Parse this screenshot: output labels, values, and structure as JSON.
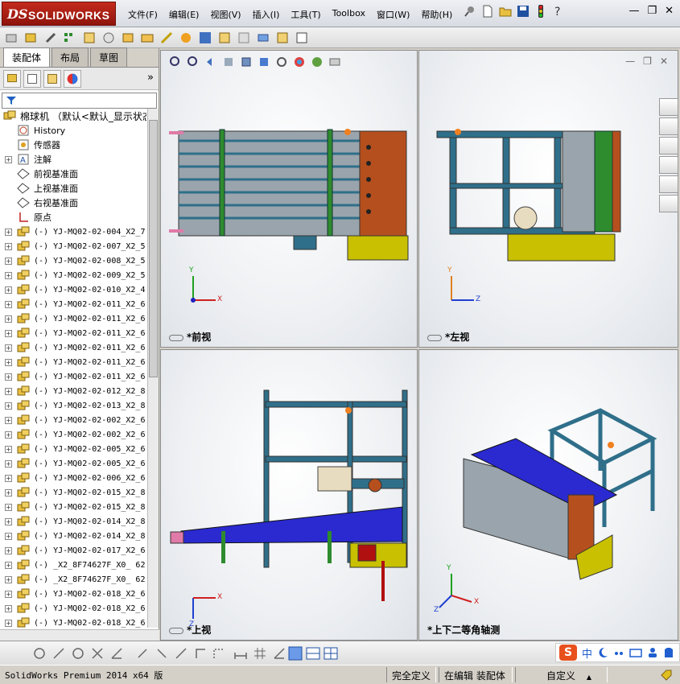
{
  "app": {
    "logo_ds": "DS",
    "logo_text": "SOLIDWORKS"
  },
  "menu": [
    "文件(F)",
    "编辑(E)",
    "视图(V)",
    "插入(I)",
    "工具(T)",
    "Toolbox",
    "窗口(W)",
    "帮助(H)"
  ],
  "window_controls": {
    "minimize": "—",
    "restore": "❐",
    "close": "✕"
  },
  "left_panel": {
    "tabs": [
      "装配体",
      "布局",
      "草图"
    ],
    "active_tab": "装配体",
    "more": "»",
    "root": "棉球机 （默认<默认_显示状态",
    "items": [
      {
        "label": "History",
        "icon": "history-icon",
        "expand": false,
        "mono": false
      },
      {
        "label": "传感器",
        "icon": "sensor-icon",
        "expand": false,
        "mono": false
      },
      {
        "label": "注解",
        "icon": "annotation-icon",
        "expand": true,
        "mono": false
      },
      {
        "label": "前视基准面",
        "icon": "plane-icon",
        "expand": false,
        "mono": false
      },
      {
        "label": "上视基准面",
        "icon": "plane-icon",
        "expand": false,
        "mono": false
      },
      {
        "label": "右视基准面",
        "icon": "plane-icon",
        "expand": false,
        "mono": false
      },
      {
        "label": "原点",
        "icon": "origin-icon",
        "expand": false,
        "mono": false
      },
      {
        "label": "(-) YJ-MQ02-02-004_X2_7",
        "icon": "part-icon",
        "expand": true,
        "mono": true
      },
      {
        "label": "(-) YJ-MQ02-02-007_X2_5",
        "icon": "part-icon",
        "expand": true,
        "mono": true
      },
      {
        "label": "(-) YJ-MQ02-02-008_X2_5",
        "icon": "part-icon",
        "expand": true,
        "mono": true
      },
      {
        "label": "(-) YJ-MQ02-02-009_X2_5",
        "icon": "part-icon",
        "expand": true,
        "mono": true
      },
      {
        "label": "(-) YJ-MQ02-02-010_X2_4",
        "icon": "part-icon",
        "expand": true,
        "mono": true
      },
      {
        "label": "(-) YJ-MQ02-02-011_X2_6",
        "icon": "part-icon",
        "expand": true,
        "mono": true
      },
      {
        "label": "(-) YJ-MQ02-02-011_X2_6",
        "icon": "part-icon",
        "expand": true,
        "mono": true
      },
      {
        "label": "(-) YJ-MQ02-02-011_X2_6",
        "icon": "part-icon",
        "expand": true,
        "mono": true
      },
      {
        "label": "(-) YJ-MQ02-02-011_X2_6",
        "icon": "part-icon",
        "expand": true,
        "mono": true
      },
      {
        "label": "(-) YJ-MQ02-02-011_X2_6",
        "icon": "part-icon",
        "expand": true,
        "mono": true
      },
      {
        "label": "(-) YJ-MQ02-02-011_X2_6",
        "icon": "part-icon",
        "expand": true,
        "mono": true
      },
      {
        "label": "(-) YJ-MQ02-02-012_X2_8",
        "icon": "part-icon",
        "expand": true,
        "mono": true
      },
      {
        "label": "(-) YJ-MQ02-02-013_X2_8",
        "icon": "part-icon",
        "expand": true,
        "mono": true
      },
      {
        "label": "(-) YJ-MQ02-02-002_X2_6",
        "icon": "part-icon",
        "expand": true,
        "mono": true
      },
      {
        "label": "(-) YJ-MQ02-02-002_X2_6",
        "icon": "part-icon",
        "expand": true,
        "mono": true
      },
      {
        "label": "(-) YJ-MQ02-02-005_X2_6",
        "icon": "part-icon",
        "expand": true,
        "mono": true
      },
      {
        "label": "(-) YJ-MQ02-02-005_X2_6",
        "icon": "part-icon",
        "expand": true,
        "mono": true
      },
      {
        "label": "(-) YJ-MQ02-02-006_X2_6",
        "icon": "part-icon",
        "expand": true,
        "mono": true
      },
      {
        "label": "(-) YJ-MQ02-02-015_X2_8",
        "icon": "part-icon",
        "expand": true,
        "mono": true
      },
      {
        "label": "(-) YJ-MQ02-02-015_X2_8",
        "icon": "part-icon",
        "expand": true,
        "mono": true
      },
      {
        "label": "(-) YJ-MQ02-02-014_X2_8",
        "icon": "part-icon",
        "expand": true,
        "mono": true
      },
      {
        "label": "(-) YJ-MQ02-02-014_X2_8",
        "icon": "part-icon",
        "expand": true,
        "mono": true
      },
      {
        "label": "(-) YJ-MQ02-02-017_X2_6",
        "icon": "part-icon",
        "expand": true,
        "mono": true
      },
      {
        "label": "(-) _X2_8F74627F_X0_ 62",
        "icon": "part-icon",
        "expand": true,
        "mono": true
      },
      {
        "label": "(-) _X2_8F74627F_X0_ 62",
        "icon": "part-icon",
        "expand": true,
        "mono": true
      },
      {
        "label": "(-) YJ-MQ02-02-018_X2_6",
        "icon": "part-icon",
        "expand": true,
        "mono": true
      },
      {
        "label": "(-) YJ-MQ02-02-018_X2_6",
        "icon": "part-icon",
        "expand": true,
        "mono": true
      },
      {
        "label": "(-) YJ-MQ02-02-018_X2_6",
        "icon": "part-icon",
        "expand": true,
        "mono": true
      }
    ]
  },
  "viewports": {
    "front": {
      "label": "*前视",
      "axis_x": "X",
      "axis_y": "Y"
    },
    "left": {
      "label": "*左视",
      "axis_x": "Z",
      "axis_y": "Y"
    },
    "top": {
      "label": "*上视",
      "axis_x": "X",
      "axis_y": "Z"
    },
    "iso": {
      "label": "*上下二等角轴测",
      "axis_x": "X",
      "axis_y": "Y",
      "axis_z": "Z"
    }
  },
  "ime": {
    "logo": "S",
    "lang": "中"
  },
  "status": {
    "product": "SolidWorks Premium 2014 x64 版",
    "constraint": "完全定义",
    "mode": "在编辑 装配体",
    "units": "自定义",
    "units_arrow": "▲"
  },
  "colors": {
    "frame_blue": "#2f6f8a",
    "roller_green": "#2e8b2e",
    "motor_orange": "#b5501e",
    "base_yellow": "#c8c000",
    "conveyor_blue": "#2a2ad0",
    "inlet_pink": "#e07aa8"
  }
}
